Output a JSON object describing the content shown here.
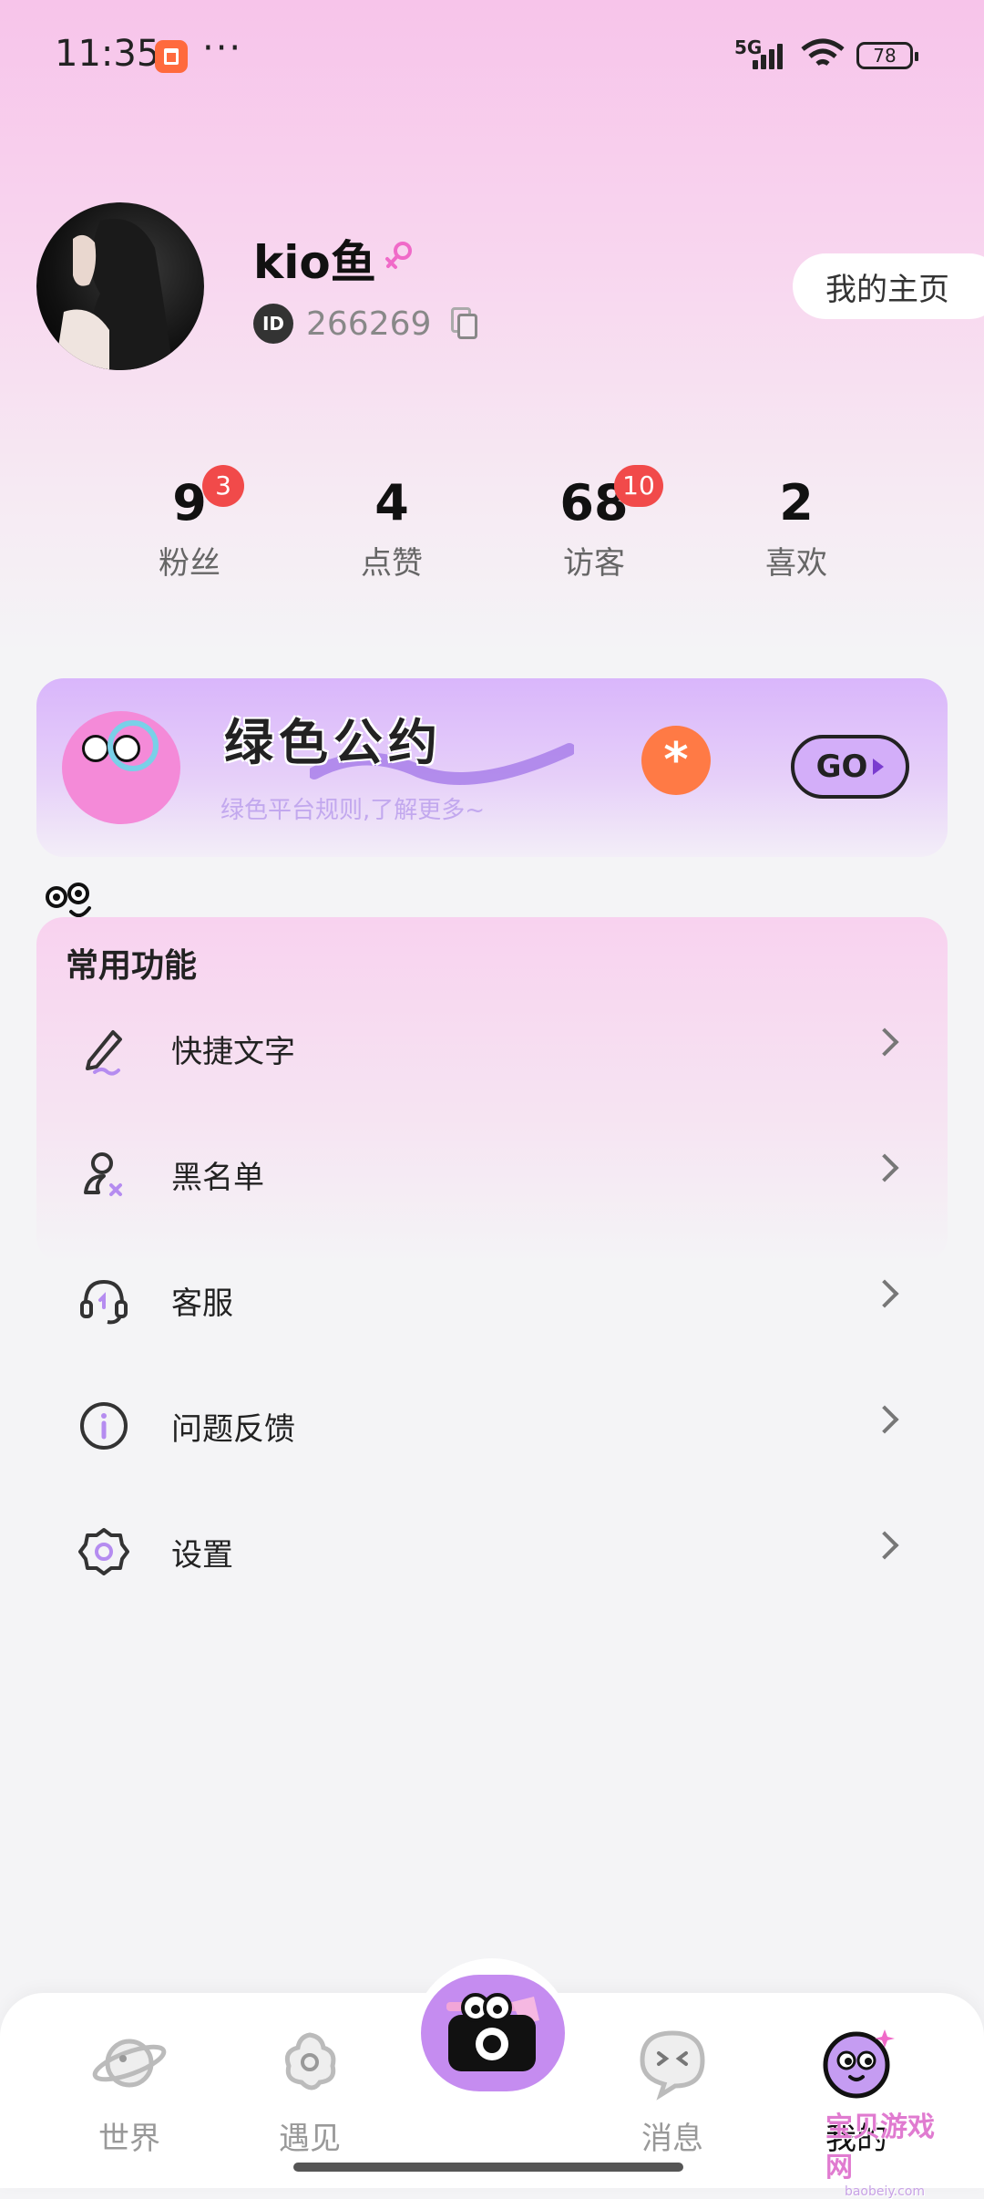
{
  "status_bar": {
    "time": "11:35",
    "more": "···",
    "network": "5G",
    "battery": "78"
  },
  "profile": {
    "username": "kio鱼",
    "gender_icon": "female-icon",
    "id_label": "ID",
    "id_number": "266269",
    "home_button": "我的主页"
  },
  "stats": [
    {
      "value": "9",
      "label": "粉丝",
      "badge": "3"
    },
    {
      "value": "4",
      "label": "点赞",
      "badge": ""
    },
    {
      "value": "68",
      "label": "访客",
      "badge": "10"
    },
    {
      "value": "2",
      "label": "喜欢",
      "badge": ""
    }
  ],
  "banner": {
    "title": "绿色公约",
    "subtitle": "绿色平台规则,了解更多~",
    "star": "*",
    "go": "GO"
  },
  "functions": {
    "title": "常用功能",
    "items": [
      {
        "label": "快捷文字",
        "icon": "pen-icon"
      },
      {
        "label": "黑名单",
        "icon": "user-block-icon"
      },
      {
        "label": "客服",
        "icon": "headset-icon"
      },
      {
        "label": "问题反馈",
        "icon": "info-icon"
      },
      {
        "label": "设置",
        "icon": "gear-icon"
      }
    ]
  },
  "tabbar": {
    "tabs": [
      {
        "label": "世界",
        "icon": "planet-icon"
      },
      {
        "label": "遇见",
        "icon": "flower-icon"
      },
      {
        "label": "",
        "icon": "camera-icon"
      },
      {
        "label": "消息",
        "icon": "chat-face-icon"
      },
      {
        "label": "我的",
        "icon": "moon-face-icon"
      }
    ]
  },
  "watermark": {
    "text": "宝贝游戏网",
    "url": "baobeiy.com"
  },
  "colors": {
    "accent": "#c58cf0",
    "badge": "#f14a4a",
    "gender": "#f06ac8",
    "banner_star": "#ff7a45"
  }
}
